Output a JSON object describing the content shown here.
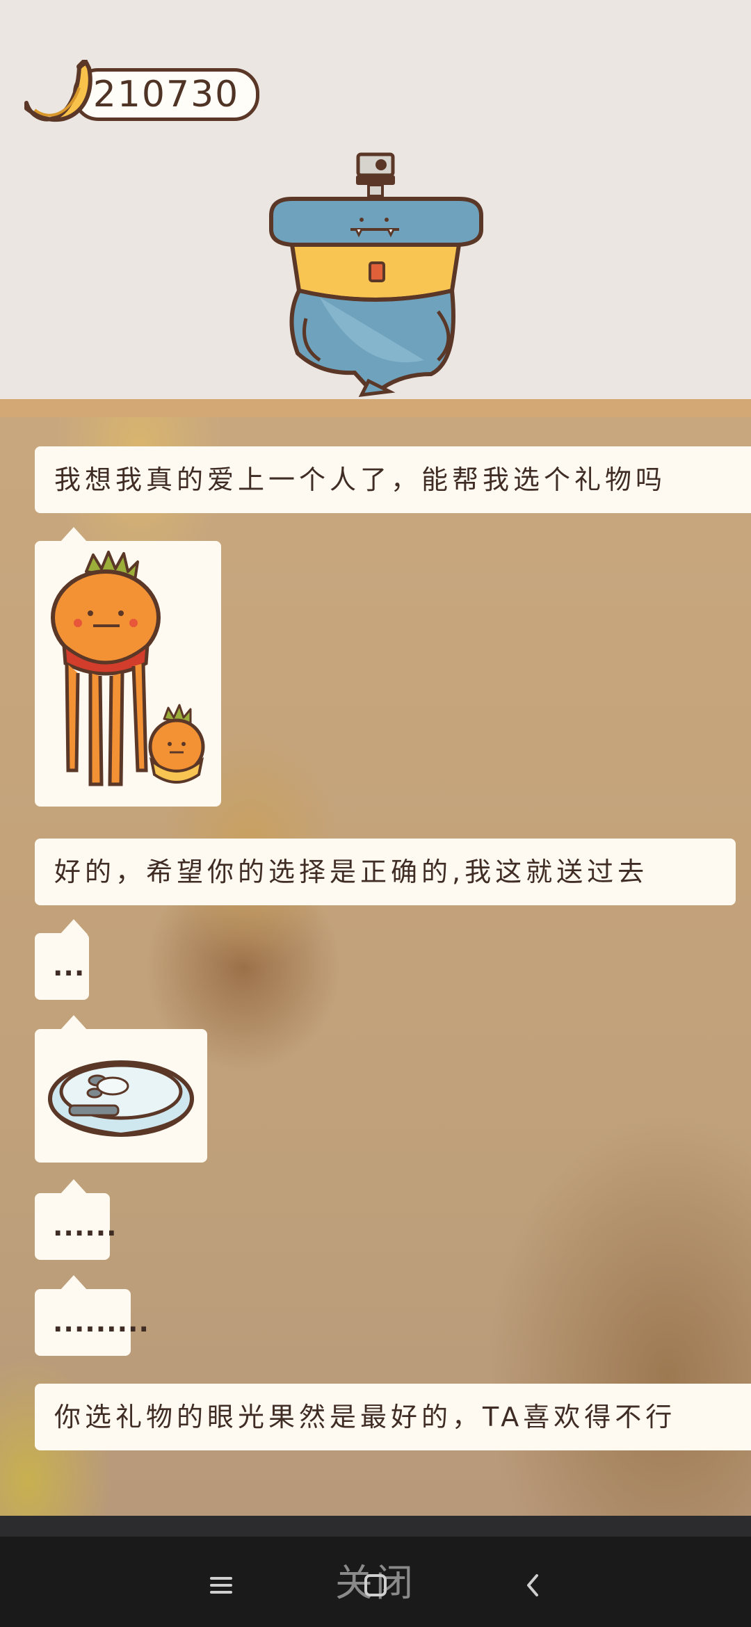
{
  "header": {
    "banana_count": "210730"
  },
  "chat": {
    "messages": [
      {
        "type": "text",
        "text": "我想我真的爱上一个人了，能帮我选个礼物吗"
      },
      {
        "type": "image",
        "icon": "carrot-character-icon"
      },
      {
        "type": "text",
        "text": "好的，希望你的选择是正确的,我这就送过去"
      },
      {
        "type": "text",
        "text": "..."
      },
      {
        "type": "image",
        "icon": "robot-vacuum-icon"
      },
      {
        "type": "text",
        "text": "......"
      },
      {
        "type": "text",
        "text": "........."
      },
      {
        "type": "text",
        "text": "你选礼物的眼光果然是最好的，TA喜欢得不行"
      }
    ]
  },
  "footer": {
    "close_label": "关闭"
  },
  "colors": {
    "outline": "#5a3727",
    "bubble": "#fffaf1",
    "divider": "#d4a874",
    "whale_blue": "#6fa2bd",
    "belt_yellow": "#f8c552"
  }
}
